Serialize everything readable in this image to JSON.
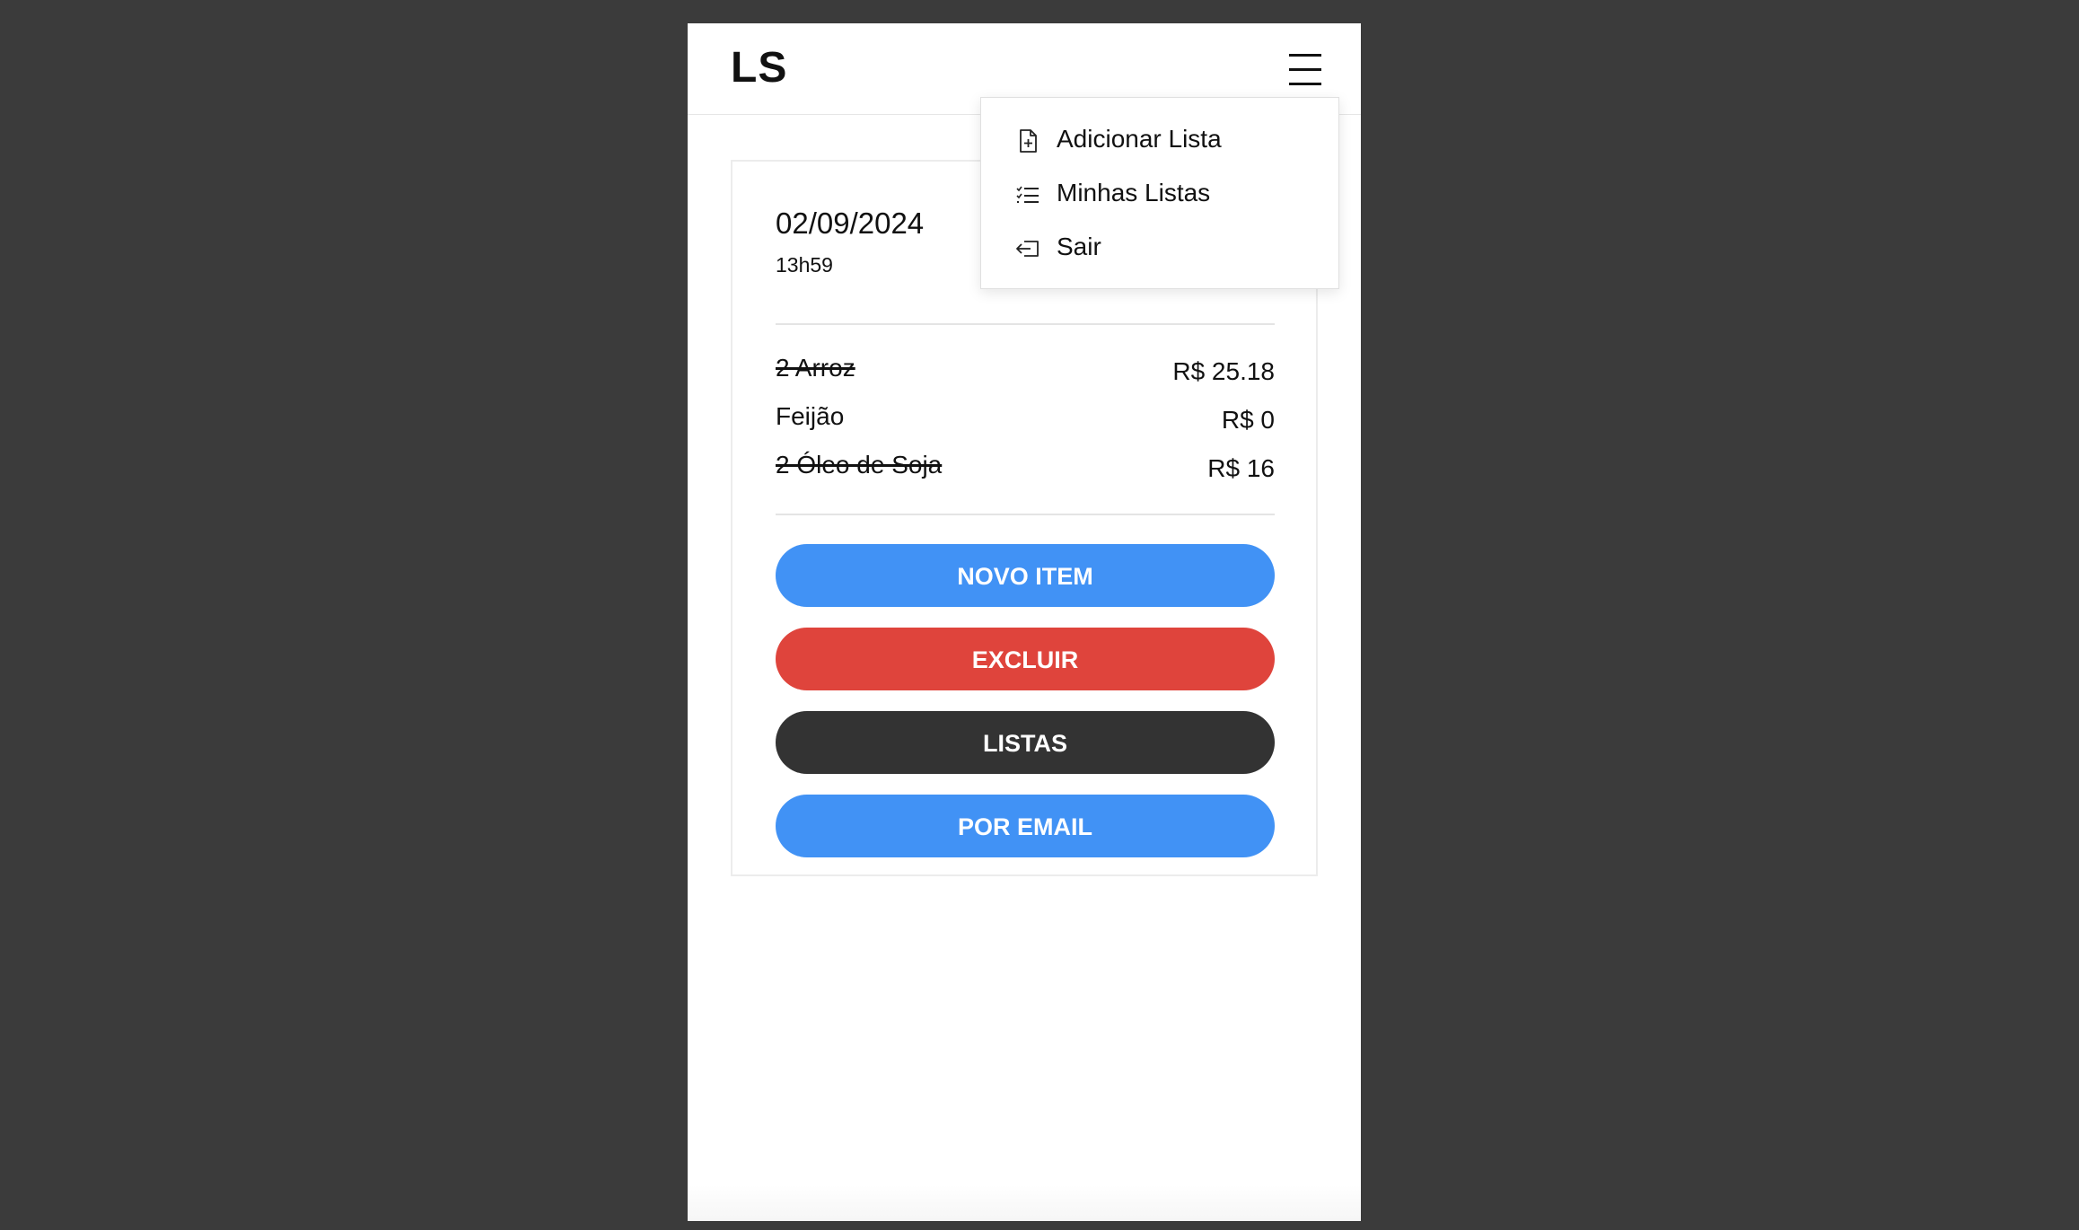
{
  "header": {
    "logo": "LS",
    "menu_icon": "hamburger-menu-icon"
  },
  "list": {
    "date": "02/09/2024",
    "time": "13h59",
    "items": [
      {
        "name": "2 Arroz",
        "price": "R$ 25.18",
        "checked": true
      },
      {
        "name": "Feijão",
        "price": "R$ 0",
        "checked": false
      },
      {
        "name": "2 Óleo de Soja",
        "price": "R$ 16",
        "checked": true
      }
    ]
  },
  "buttons": {
    "new_item": "NOVO ITEM",
    "delete": "EXCLUIR",
    "lists": "LISTAS",
    "email": "POR EMAIL"
  },
  "menu": {
    "items": [
      {
        "label": "Adicionar Lista",
        "icon": "file-plus-icon"
      },
      {
        "label": "Minhas Listas",
        "icon": "checklist-icon"
      },
      {
        "label": "Sair",
        "icon": "logout-icon"
      }
    ]
  },
  "colors": {
    "background": "#3b3b3b",
    "blue": "#4192f5",
    "red": "#df443c",
    "dark": "#333333"
  }
}
